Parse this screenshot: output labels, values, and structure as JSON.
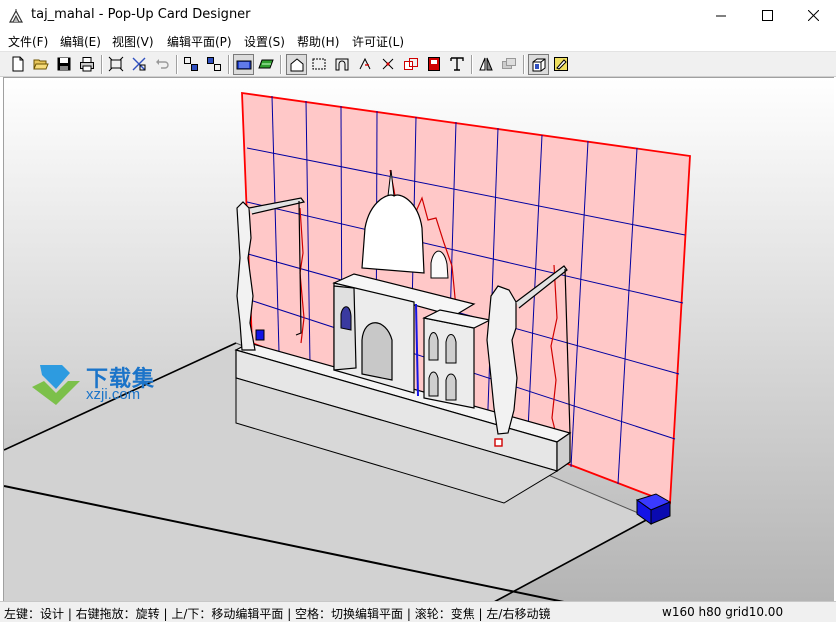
{
  "window": {
    "title": "taj_mahal - Pop-Up Card Designer",
    "controls": [
      "minimize",
      "maximize",
      "close"
    ]
  },
  "menu": {
    "items": [
      {
        "label": "文件(F)"
      },
      {
        "label": "编辑(E)"
      },
      {
        "label": "视图(V)"
      },
      {
        "label": "编辑平面(P)"
      },
      {
        "label": "设置(S)"
      },
      {
        "label": "帮助(H)"
      },
      {
        "label": "许可证(L)"
      }
    ]
  },
  "toolbar": {
    "buttons": [
      {
        "icon": "new-file-icon"
      },
      {
        "icon": "open-folder-icon"
      },
      {
        "icon": "save-disk-icon"
      },
      {
        "icon": "print-icon"
      },
      {
        "icon": "fit-view-icon"
      },
      {
        "icon": "pointer-cross-icon"
      },
      {
        "icon": "undo-icon"
      },
      {
        "icon": "group-icon"
      },
      {
        "icon": "ungroup-icon"
      },
      {
        "icon": "blue-view-icon",
        "active": true
      },
      {
        "icon": "green-view-icon"
      },
      {
        "icon": "house-shape-icon",
        "active": true
      },
      {
        "icon": "dashed-rect-icon"
      },
      {
        "icon": "arch-icon"
      },
      {
        "icon": "arrow-fold-icon"
      },
      {
        "icon": "x-fold-icon"
      },
      {
        "icon": "red-squares-icon"
      },
      {
        "icon": "red-page-icon"
      },
      {
        "icon": "text-t-icon"
      },
      {
        "icon": "triangle-mirror-icon"
      },
      {
        "icon": "layers-icon"
      },
      {
        "icon": "cube-3d-icon",
        "active": true
      },
      {
        "icon": "yellow-pencil-icon"
      }
    ]
  },
  "watermark": {
    "title": "下载集",
    "url": "xzji.com"
  },
  "status": {
    "hint": "左键：设计 | 右键拖放：旋转 | 上/下：移动编辑平面 | 空格：切换编辑平面 | 滚轮：变焦 | 左/右移动镜",
    "dimensions": "w160 h80 grid10.00"
  },
  "colors": {
    "edit_plane_fill": "#ffc8c8",
    "edit_plane_border": "#ff0000",
    "grid_lines": "#0000a0",
    "viewport_top": "#ffffff",
    "viewport_bottom": "#b4b4b4",
    "handle": "#1414e6"
  }
}
